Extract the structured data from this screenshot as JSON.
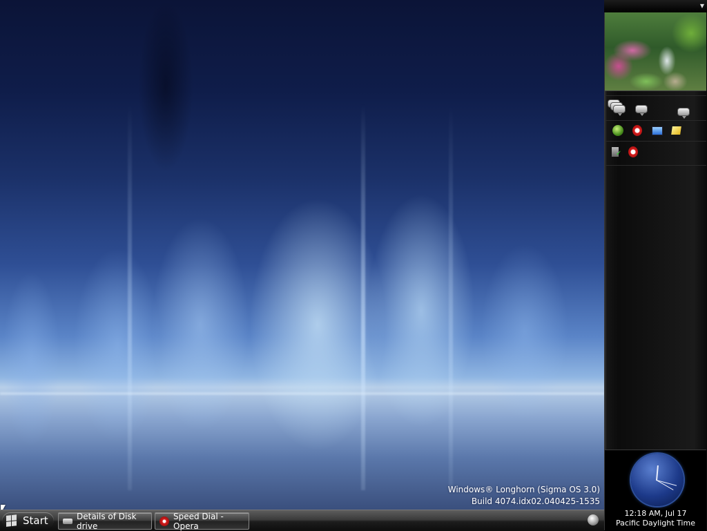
{
  "desktop": {
    "watermark_line1": "Windows® Longhorn (Sigma OS 3.0)",
    "watermark_line2": "Build 4074.idx02.040425-1535"
  },
  "taskbar": {
    "start_label": "Start",
    "tasks": [
      {
        "label": "Details of Disk drive",
        "icon": "disk-drive-icon"
      },
      {
        "label": "Speed Dial - Opera",
        "icon": "opera-icon"
      }
    ]
  },
  "sidebar": {
    "tile_rows": [
      [
        "contacts-icon",
        "messenger-icon",
        "chat-icon"
      ],
      [
        "green-orb-icon",
        "opera-icon",
        "monitor-icon",
        "sticky-note-icon"
      ],
      [
        "security-shield-icon",
        "opera-icon"
      ]
    ],
    "clock": {
      "time": "12:18 AM, Jul 17",
      "zone": "Pacific Daylight Time"
    }
  },
  "colors": {
    "sidebar_bg": "#0c0c0c",
    "clock_blue": "#1d3a8a",
    "opera_red": "#d81d1d"
  }
}
